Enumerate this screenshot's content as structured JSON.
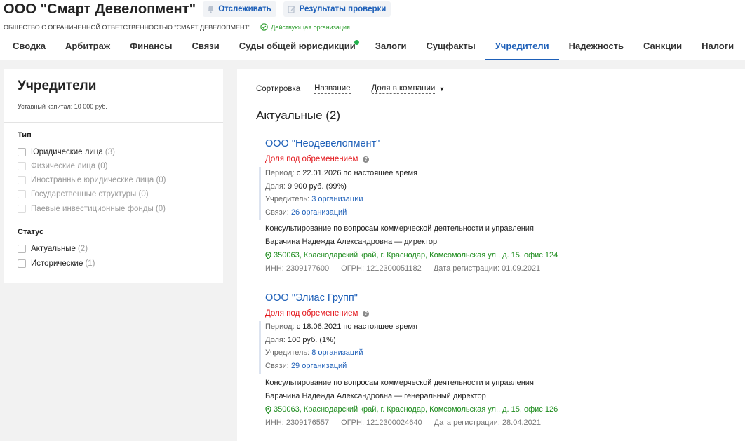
{
  "header": {
    "company_title": "ООО \"Смарт Девелопмент\"",
    "track_label": "Отслеживать",
    "check_label": "Результаты проверки",
    "full_name": "ОБЩЕСТВО С ОГРАНИЧЕННОЙ ОТВЕТСТВЕННОСТЬЮ \"СМАРТ ДЕВЕЛОПМЕНТ\"",
    "status": "Действующая организация"
  },
  "tabs": [
    {
      "label": "Сводка"
    },
    {
      "label": "Арбитраж"
    },
    {
      "label": "Финансы"
    },
    {
      "label": "Связи"
    },
    {
      "label": "Суды общей юрисдикции"
    },
    {
      "label": "Залоги"
    },
    {
      "label": "Сущфакты"
    },
    {
      "label": "Учредители"
    },
    {
      "label": "Надежность"
    },
    {
      "label": "Санкции"
    },
    {
      "label": "Налоги"
    }
  ],
  "colors": {
    "accent": "#1d5fb8",
    "danger": "#e3161b",
    "success": "#1c8b1c",
    "indicator": "#22b14c"
  },
  "sidebar": {
    "title": "Учредители",
    "capital": "Уставный капитал: 10 000 руб.",
    "type_title": "Тип",
    "types": [
      {
        "label": "Юридические лица",
        "count": "(3)"
      },
      {
        "label": "Физические лица (0)"
      },
      {
        "label": "Иностранные юридические лица (0)"
      },
      {
        "label": "Государственные структуры (0)"
      },
      {
        "label": "Паевые инвестиционные фонды (0)"
      }
    ],
    "status_title": "Статус",
    "statuses": [
      {
        "label": "Актуальные",
        "count": "(2)"
      },
      {
        "label": "Исторические",
        "count": "(1)"
      }
    ]
  },
  "main": {
    "sort_label": "Сортировка",
    "sort_name": "Название",
    "sort_share": "Доля в компании",
    "section_title": "Актуальные (2)",
    "orgs": [
      {
        "name": "ООО \"Неодевелопмент\"",
        "pledge": "Доля под обременением",
        "period_label": "Период:",
        "period": "с 22.01.2026 по настоящее время",
        "share_label": "Доля:",
        "share": "9 900 руб. (99%)",
        "founder_label": "Учредитель:",
        "founder_link": "3 организации",
        "links_label": "Связи:",
        "links_link": "26 организаций",
        "activity": "Консультирование по вопросам коммерческой деятельности и управления",
        "director": "Барачина Надежда Александровна — директор",
        "address": "350063, Краснодарский край, г. Краснодар, Комсомольская ул., д. 15, офис 124",
        "inn": "ИНН: 2309177600",
        "ogrn": "ОГРН: 1212300051182",
        "reg_date": "Дата регистрации: 01.09.2021"
      },
      {
        "name": "ООО \"Элиас Групп\"",
        "pledge": "Доля под обременением",
        "period_label": "Период:",
        "period": "с 18.06.2021 по настоящее время",
        "share_label": "Доля:",
        "share": "100 руб. (1%)",
        "founder_label": "Учредитель:",
        "founder_link": "8 организаций",
        "links_label": "Связи:",
        "links_link": "29 организаций",
        "activity": "Консультирование по вопросам коммерческой деятельности и управления",
        "director": "Барачина Надежда Александровна — генеральный директор",
        "address": "350063, Краснодарский край, г. Краснодар, Комсомольская ул., д. 15, офис 126",
        "inn": "ИНН: 2309176557",
        "ogrn": "ОГРН: 1212300024640",
        "reg_date": "Дата регистрации: 28.04.2021"
      }
    ]
  }
}
